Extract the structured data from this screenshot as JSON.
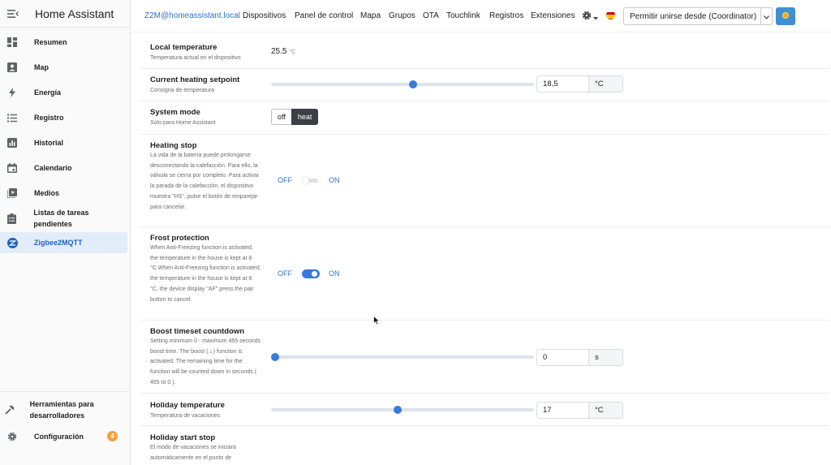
{
  "app": {
    "title": "Home Assistant"
  },
  "sidebar": {
    "items": [
      {
        "label": "Resumen",
        "icon": "dashboard-icon"
      },
      {
        "label": "Map",
        "icon": "map-icon"
      },
      {
        "label": "Energía",
        "icon": "lightning-bolt-icon"
      },
      {
        "label": "Registro",
        "icon": "list-icon"
      },
      {
        "label": "Historial",
        "icon": "chart-bar-icon"
      },
      {
        "label": "Calendario",
        "icon": "calendar-icon"
      },
      {
        "label": "Medios",
        "icon": "play-box-icon"
      },
      {
        "label": "Listas de tareas pendientes",
        "icon": "clipboard-list-icon"
      },
      {
        "label": "Zigbee2MQTT",
        "icon": "zigbee-icon",
        "active": true
      }
    ],
    "bottom": [
      {
        "label": "Herramientas para desarrolladores",
        "icon": "hammer-icon"
      },
      {
        "label": "Configuración",
        "icon": "gear-icon",
        "badge": "4"
      }
    ]
  },
  "topbar": {
    "host": "Z2M@homeassistant.local",
    "nav": [
      "Dispositivos",
      "Panel de control",
      "Mapa",
      "Grupos",
      "OTA",
      "Touchlink",
      "Registros",
      "Extensiones"
    ],
    "permit_join_label": "Permitir unirse desde (Coordinator)"
  },
  "settings": {
    "local_temperature": {
      "label": "Local temperature",
      "desc": "Temperatura actual en el dispositivo",
      "value": "25.5",
      "unit": "°C"
    },
    "heating_setpoint": {
      "label": "Current heating setpoint",
      "desc": "Consigna de temperatura",
      "value": "18,5",
      "unit": "°C",
      "fraction": 0.54
    },
    "system_mode": {
      "label": "System mode",
      "desc": "Solo para Home Assistant",
      "options": [
        "off",
        "heat"
      ],
      "selected": "heat"
    },
    "heating_stop": {
      "label": "Heating stop",
      "desc": "La vida de la batería puede prolongarse desconectando la calefacción. Para ello, la válvula se cierra por completo. Para activar la parada de la calefacción, el dispositivo muestra \"HS\", pulse el botón de emparejar para cancelar.",
      "off_label": "OFF",
      "on_label": "ON",
      "state": false
    },
    "frost_protection": {
      "label": "Frost protection",
      "desc": "When Anti-Freezing function is activated, the temperature in the house is kept at 8 °C.When Anti-Freezing function is activated, the temperature in the house is kept at 8 °C, the device display \"AF\".press the pair button to cancel.",
      "off_label": "OFF",
      "on_label": "ON",
      "state": true
    },
    "boost_timeset": {
      "label": "Boost timeset countdown",
      "desc": "Setting minimum 0 - maximum 465 seconds boost time. The boost (♨) function is activated. The remaining time for the function will be counted down in seconds ( 465 to 0 ).",
      "value": "0",
      "unit": "s",
      "fraction": 0.0
    },
    "holiday_temperature": {
      "label": "Holiday temperature",
      "desc": "Temperatura de vacaciones",
      "value": "17",
      "unit": "°C",
      "fraction": 0.48
    },
    "holiday_start_stop": {
      "label": "Holiday start stop",
      "desc": "El modo de vacaciones se iniciará automáticamente en el punto de"
    }
  },
  "colors": {
    "accent": "#3a78db",
    "active_bg": "#e3edf9",
    "link": "#2c6fc6",
    "badge": "#f2a33a"
  }
}
